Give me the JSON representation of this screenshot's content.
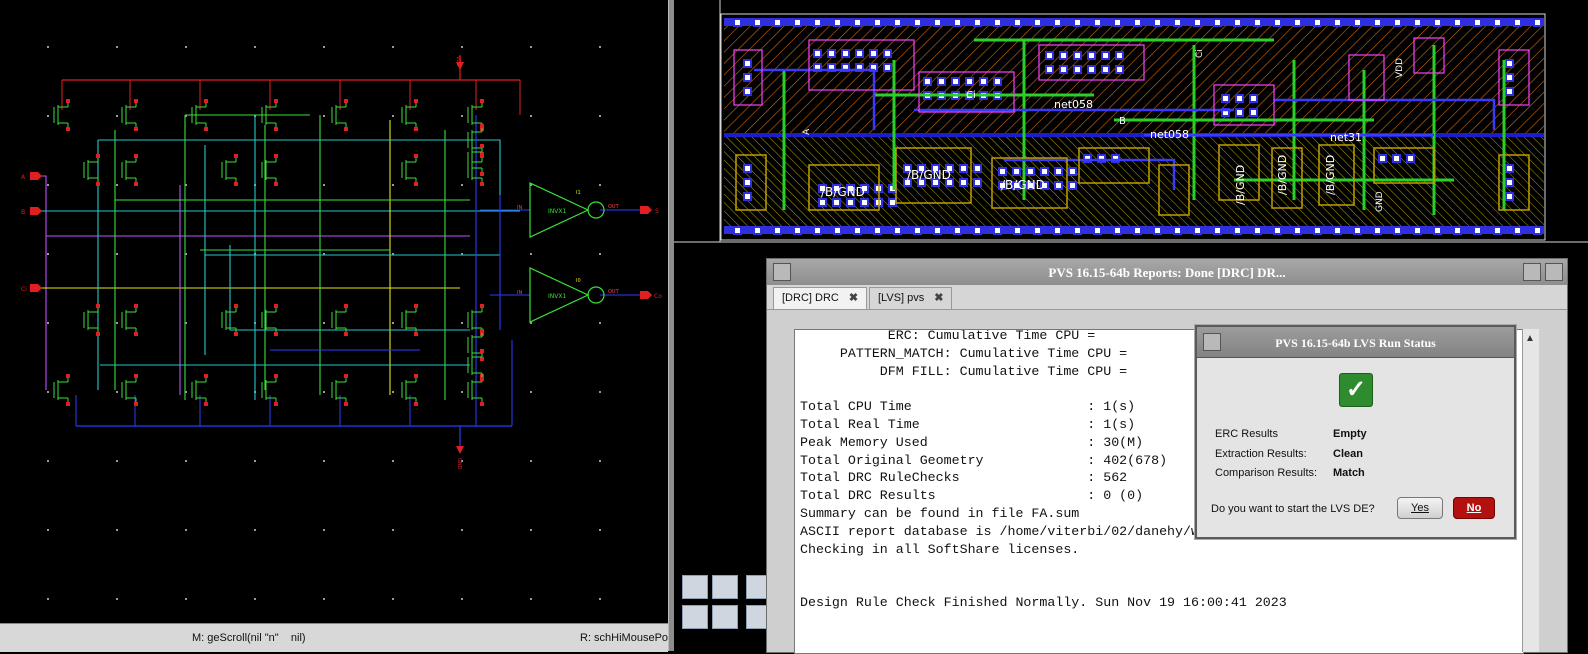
{
  "schematic": {
    "pins": {
      "a": "A",
      "b": "B",
      "ci": "Ci",
      "s": "S",
      "co": "Co"
    },
    "inverters": [
      {
        "label": "INVX1",
        "in_pin": "IN",
        "out_pin": "OUT",
        "vdd": "VDD",
        "gnd": "GND",
        "inst": "I1"
      },
      {
        "label": "INVX1",
        "in_pin": "IN",
        "out_pin": "OUT",
        "vdd": "VDD",
        "gnd": "GND",
        "inst": "I0"
      }
    ],
    "supply_top": "VDD",
    "supply_bottom": "GND",
    "status_left": "M: geScroll(nil \"n\"    nil)",
    "status_right": "R: schHiMousePo"
  },
  "layout": {
    "labels": [
      "VDD",
      "A",
      "/B/GND",
      "/B/GND",
      "/B/GND",
      "/B/GND",
      "/B/GND",
      "/B/GND",
      "/B/GND",
      "net058",
      "net058",
      "net31",
      "Ci",
      "Ci",
      "B",
      "GND"
    ]
  },
  "pvs": {
    "title": "PVS 16.15-64b  Reports: Done [DRC] DR...",
    "tabs": [
      {
        "label": "[DRC] DRC",
        "close": "✖"
      },
      {
        "label": "[LVS] pvs",
        "close": "✖"
      }
    ],
    "report_lines": [
      "           ERC: Cumulative Time CPU =",
      "     PATTERN_MATCH: Cumulative Time CPU =",
      "          DFM FILL: Cumulative Time CPU =",
      "",
      "Total CPU Time                      : 1(s)",
      "Total Real Time                     : 1(s)",
      "Peak Memory Used                    : 30(M)",
      "Total Original Geometry             : 402(678)",
      "Total DRC RuleChecks                : 562",
      "Total DRC Results                   : 0 (0)",
      "Summary can be found in file FA.sum",
      "ASCII report database is /home/viterbi/02/danehy/work_gpdk045/DRC/FA.drc_errors.asc",
      "Checking in all SoftShare licenses.",
      "",
      "",
      "Design Rule Check Finished Normally. Sun Nov 19 16:00:41 2023"
    ]
  },
  "lvs_dialog": {
    "title": "PVS 16.15-64b LVS  Run Status",
    "check_glyph": "✓",
    "results": [
      {
        "label": "ERC Results",
        "value": "Empty"
      },
      {
        "label": "Extraction Results:",
        "value": "Clean"
      },
      {
        "label": "Comparison Results:",
        "value": "Match"
      }
    ],
    "question": "Do you want to start the LVS DE?",
    "yes_label": "Yes",
    "no_label": "No",
    "colors": {
      "ok_green": "#2e8b2e",
      "no_red": "#b31010"
    }
  }
}
